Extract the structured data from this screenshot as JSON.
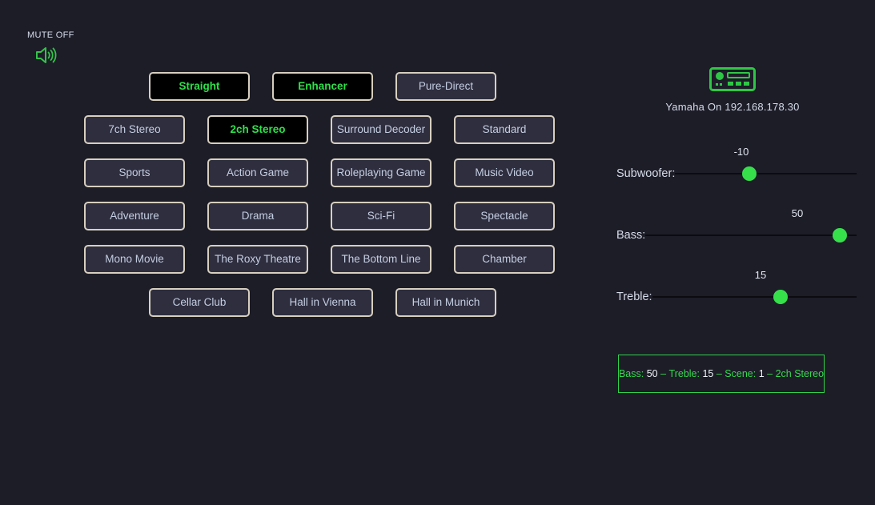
{
  "mute": {
    "label": "MUTE OFF",
    "icon": "speaker-on-icon",
    "icon_color": "#34c24a"
  },
  "programs": {
    "row_top": [
      {
        "label": "Straight",
        "active": true
      },
      {
        "label": "Enhancer",
        "active": true
      },
      {
        "label": "Pure-Direct",
        "active": false
      }
    ],
    "grid": [
      [
        {
          "label": "7ch Stereo",
          "active": false
        },
        {
          "label": "2ch Stereo",
          "active": true
        },
        {
          "label": "Surround Decoder",
          "active": false
        },
        {
          "label": "Standard",
          "active": false
        }
      ],
      [
        {
          "label": "Sports",
          "active": false
        },
        {
          "label": "Action Game",
          "active": false
        },
        {
          "label": "Roleplaying Game",
          "active": false
        },
        {
          "label": "Music Video",
          "active": false
        }
      ],
      [
        {
          "label": "Adventure",
          "active": false
        },
        {
          "label": "Drama",
          "active": false
        },
        {
          "label": "Sci-Fi",
          "active": false
        },
        {
          "label": "Spectacle",
          "active": false
        }
      ],
      [
        {
          "label": "Mono Movie",
          "active": false
        },
        {
          "label": "The Roxy Theatre",
          "active": false
        },
        {
          "label": "The Bottom Line",
          "active": false
        },
        {
          "label": "Chamber",
          "active": false
        }
      ]
    ],
    "row_bottom": [
      {
        "label": "Cellar Club",
        "active": false
      },
      {
        "label": "Hall in Vienna",
        "active": false
      },
      {
        "label": "Hall in Munich",
        "active": false
      }
    ]
  },
  "device": {
    "icon": "receiver-icon",
    "name": "Yamaha On 192.168.178.30"
  },
  "sliders": [
    {
      "label": "Subwoofer:",
      "value": "-10",
      "percent": 41
    },
    {
      "label": "Bass:",
      "value": "50",
      "percent": 92
    },
    {
      "label": "Treble:",
      "value": "15",
      "percent": 63
    }
  ],
  "status": {
    "bass_label": "Bass:",
    "bass_value": "50",
    "sep1": "–",
    "treble_label": "Treble:",
    "treble_value": "15",
    "sep2": "–",
    "scene_label": "Scene:",
    "scene_value": "1",
    "sep3": "–",
    "mode": "2ch Stereo"
  },
  "colors": {
    "background": "#1d1d28",
    "accent_green": "#35d94e",
    "button_border": "#d7cfbf",
    "button_fill": "#2e2e3e",
    "button_active_fill": "#000000"
  }
}
